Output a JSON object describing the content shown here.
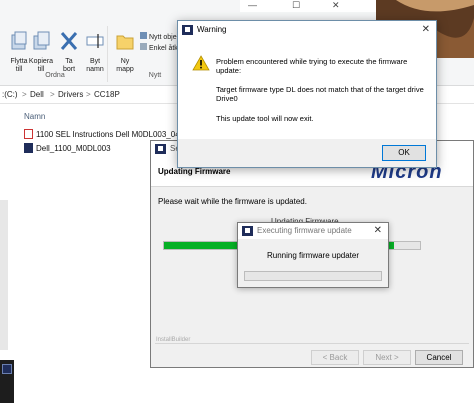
{
  "ribbon": {
    "buttons": [
      {
        "label": "Flytta\ntill",
        "caret": "▾"
      },
      {
        "label": "Kopiera\ntill",
        "caret": "▾"
      },
      {
        "label": "Ta\nbort",
        "caret": "▾"
      },
      {
        "label": "Byt\nnamn",
        "caret": ""
      },
      {
        "label": "Ny\nmapp",
        "caret": ""
      }
    ],
    "new_item": "Nytt obje",
    "easy_access": "Enkel åtk",
    "groups": {
      "ordna": "Ordna",
      "nytt": "Nytt"
    }
  },
  "address": {
    "crumbs": [
      ":(C:)",
      "Dell",
      "Drivers",
      "CC18P"
    ],
    "separator": ">"
  },
  "file_list": {
    "column_name": "Namn",
    "files": [
      {
        "name": "1100 SEL Instructions Dell M0DL003_041...",
        "icon": "pdf-icon"
      },
      {
        "name": "Dell_1100_M0DL003",
        "icon": "exe-icon"
      }
    ]
  },
  "window_controls": {
    "close": "✕",
    "minimize": "—",
    "restore": "☐"
  },
  "setup": {
    "title": "Setup",
    "heading": "Updating Firmware",
    "logo": "Micron",
    "message": "Please wait while the firmware is updated.",
    "status_partial": "Updating Firmware",
    "progress": 0.9,
    "installbuilder": "InstallBuilder",
    "back": "< Back",
    "next": "Next >",
    "cancel": "Cancel"
  },
  "exec": {
    "title": "Executing firmware update",
    "message": "Running firmware updater",
    "close": "✕"
  },
  "warning": {
    "title": "Warning",
    "close": "✕",
    "line1": "Problem encountered while trying to execute the firmware update:",
    "line2": "Target firmware type DL does not match that of the target drive Drive0",
    "line3": "This update tool will now exit.",
    "ok": "OK"
  },
  "colors": {
    "progress_green": "#06b025",
    "micron_blue": "#1e3b8a",
    "warn_yellow": "#f2c811"
  }
}
